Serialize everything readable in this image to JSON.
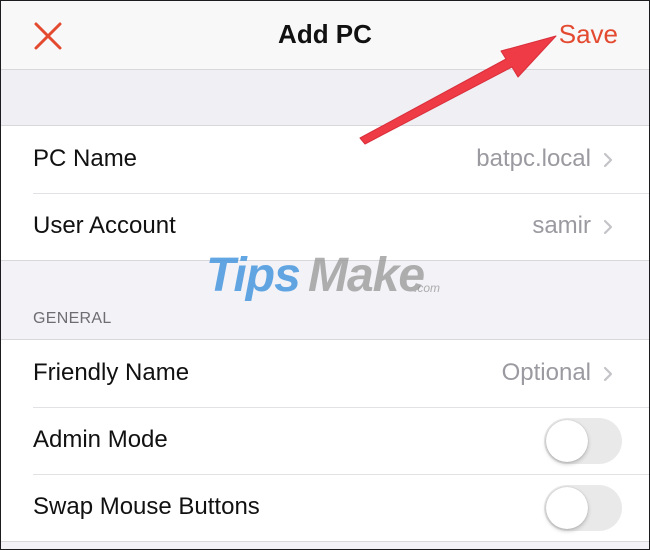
{
  "nav": {
    "title": "Add PC",
    "save_label": "Save",
    "close_icon": "close-icon",
    "accent_color": "#e34a30"
  },
  "pc_group": {
    "rows": [
      {
        "label": "PC Name",
        "value": "batpc.local"
      },
      {
        "label": "User Account",
        "value": "samir"
      }
    ]
  },
  "general": {
    "header": "GENERAL",
    "friendly_name": {
      "label": "Friendly Name",
      "placeholder": "Optional"
    },
    "admin_mode": {
      "label": "Admin Mode",
      "enabled": false
    },
    "swap_mouse": {
      "label": "Swap Mouse Buttons",
      "enabled": false
    }
  },
  "watermark": {
    "part1": "Tips",
    "part2": "Make",
    "suffix": ".com"
  },
  "annotation": {
    "arrow_color": "#ef3b45",
    "icon": "red-arrow-icon"
  }
}
